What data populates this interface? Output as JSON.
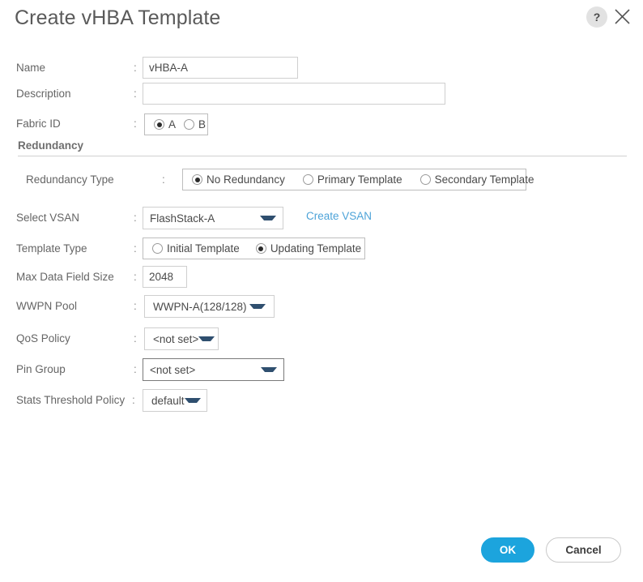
{
  "dialog": {
    "title": "Create vHBA Template",
    "help_icon": "help-circle-icon",
    "close_icon": "close-icon",
    "help_label": "?"
  },
  "fields": {
    "name": {
      "label": "Name",
      "colon": ":",
      "value": "vHBA-A",
      "placeholder": ""
    },
    "description": {
      "label": "Description",
      "colon": ":",
      "value": "",
      "placeholder": ""
    },
    "fabric_id": {
      "label": "Fabric ID",
      "colon": ":",
      "options": [
        {
          "label": "A",
          "selected": true
        },
        {
          "label": "B",
          "selected": false
        }
      ]
    },
    "redundancy_section": {
      "title": "Redundancy"
    },
    "redundancy_type": {
      "label": "Redundancy Type",
      "colon": ":",
      "options": [
        {
          "label": "No Redundancy",
          "selected": true
        },
        {
          "label": "Primary Template",
          "selected": false
        },
        {
          "label": "Secondary Template",
          "selected": false
        }
      ]
    },
    "select_vsan": {
      "label": "Select VSAN",
      "colon": ":",
      "value": "FlashStack-A",
      "link": "Create VSAN"
    },
    "template_type": {
      "label": "Template Type",
      "colon": ":",
      "options": [
        {
          "label": "Initial Template",
          "selected": false
        },
        {
          "label": "Updating Template",
          "selected": true
        }
      ]
    },
    "max_data_field_size": {
      "label": "Max Data Field Size",
      "colon": ":",
      "value": "2048"
    },
    "wwpn_pool": {
      "label": "WWPN Pool",
      "colon": ":",
      "value": "WWPN-A(128/128)"
    },
    "qos_policy": {
      "label": "QoS Policy",
      "colon": ":",
      "value": "<not set>"
    },
    "pin_group": {
      "label": "Pin Group",
      "colon": ":",
      "value": "<not set>"
    },
    "stats_threshold_policy": {
      "label": "Stats Threshold Policy",
      "colon": ":",
      "value": "default"
    }
  },
  "footer": {
    "ok_label": "OK",
    "cancel_label": "Cancel"
  },
  "colors": {
    "accent_blue": "#1ca4dd",
    "link_blue": "#4da3d8",
    "label_gray": "#656565",
    "border_gray": "#cfcfcf"
  }
}
